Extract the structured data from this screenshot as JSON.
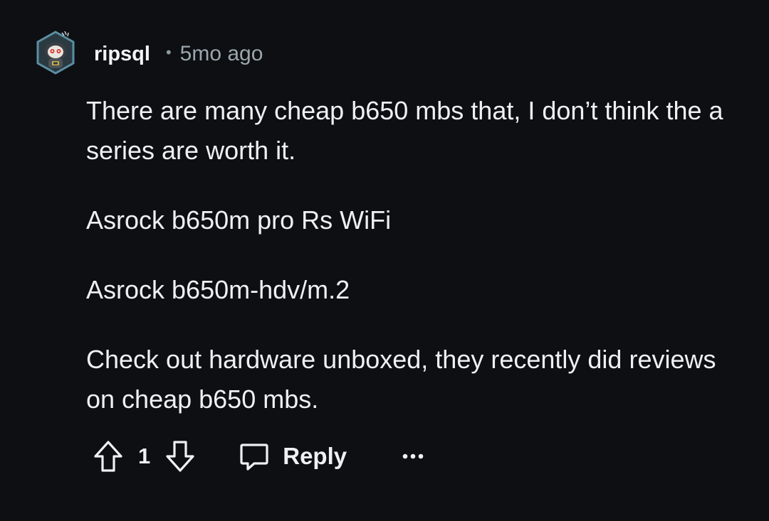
{
  "comment": {
    "author": "ripsql",
    "separator": "•",
    "timestamp": "5mo ago",
    "avatar_icon": "snoo-avatar-icon",
    "paragraphs": [
      "There are many cheap b650 mbs that, I don’t think the a series are worth it.",
      "Asrock b650m pro Rs WiFi",
      "Asrock b650m-hdv/m.2",
      "Check out hardware unboxed, they recently did reviews on cheap b650 mbs."
    ]
  },
  "actions": {
    "upvote_icon": "upvote-arrow-icon",
    "score": "1",
    "downvote_icon": "downvote-arrow-icon",
    "reply_icon": "speech-bubble-icon",
    "reply_label": "Reply",
    "more_icon": "ellipsis-icon"
  },
  "colors": {
    "background": "#0d0f12",
    "text": "#eef1f3",
    "muted": "#9aa6ad",
    "avatar_ring": "#4f7f92"
  }
}
